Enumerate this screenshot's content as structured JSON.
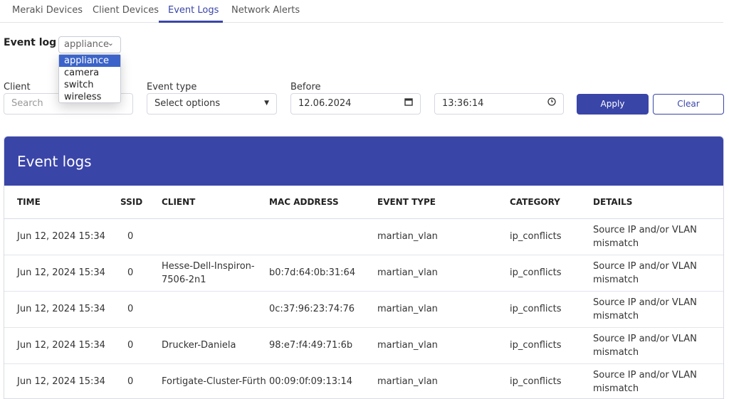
{
  "tabs": [
    {
      "label": "Meraki Devices",
      "active": false
    },
    {
      "label": "Client Devices",
      "active": false
    },
    {
      "label": "Event Logs",
      "active": true
    },
    {
      "label": "Network Alerts",
      "active": false
    }
  ],
  "event_log": {
    "label": "Event log",
    "selected": "appliance",
    "options": [
      "appliance",
      "camera",
      "switch",
      "wireless"
    ]
  },
  "filters": {
    "client_label": "Client",
    "client_placeholder": "Search",
    "event_type_label": "Event type",
    "event_type_value": "Select options",
    "before_label": "Before",
    "date_value": "12.06.2024",
    "time_value": "13:36:14",
    "apply_label": "Apply",
    "clear_label": "Clear"
  },
  "table": {
    "title": "Event logs",
    "headers": {
      "time": "TIME",
      "ssid": "SSID",
      "client": "CLIENT",
      "mac": "MAC ADDRESS",
      "event_type": "EVENT TYPE",
      "category": "CATEGORY",
      "details": "DETAILS"
    },
    "rows": [
      {
        "time": "Jun 12, 2024 15:34",
        "ssid": "0",
        "client": "",
        "mac": "",
        "event_type": "martian_vlan",
        "category": "ip_conflicts",
        "details": "Source IP and/or VLAN mismatch"
      },
      {
        "time": "Jun 12, 2024 15:34",
        "ssid": "0",
        "client": "Hesse-Dell-Inspiron-7506-2n1",
        "mac": "b0:7d:64:0b:31:64",
        "event_type": "martian_vlan",
        "category": "ip_conflicts",
        "details": "Source IP and/or VLAN mismatch"
      },
      {
        "time": "Jun 12, 2024 15:34",
        "ssid": "0",
        "client": "",
        "mac": "0c:37:96:23:74:76",
        "event_type": "martian_vlan",
        "category": "ip_conflicts",
        "details": "Source IP and/or VLAN mismatch"
      },
      {
        "time": "Jun 12, 2024 15:34",
        "ssid": "0",
        "client": "Drucker-Daniela",
        "mac": "98:e7:f4:49:71:6b",
        "event_type": "martian_vlan",
        "category": "ip_conflicts",
        "details": "Source IP and/or VLAN mismatch"
      },
      {
        "time": "Jun 12, 2024 15:34",
        "ssid": "0",
        "client": "Fortigate-Cluster-Fürth",
        "mac": "00:09:0f:09:13:14",
        "event_type": "martian_vlan",
        "category": "ip_conflicts",
        "details": "Source IP and/or VLAN mismatch"
      }
    ]
  },
  "colors": {
    "accent": "#3a45a8",
    "dropdown_highlight": "#3b63c9"
  },
  "icons": {
    "event_log_chevron": "chevron-down-icon",
    "event_type_caret": "caret-down-icon",
    "date_picker": "calendar-icon",
    "time_picker": "clock-icon"
  }
}
